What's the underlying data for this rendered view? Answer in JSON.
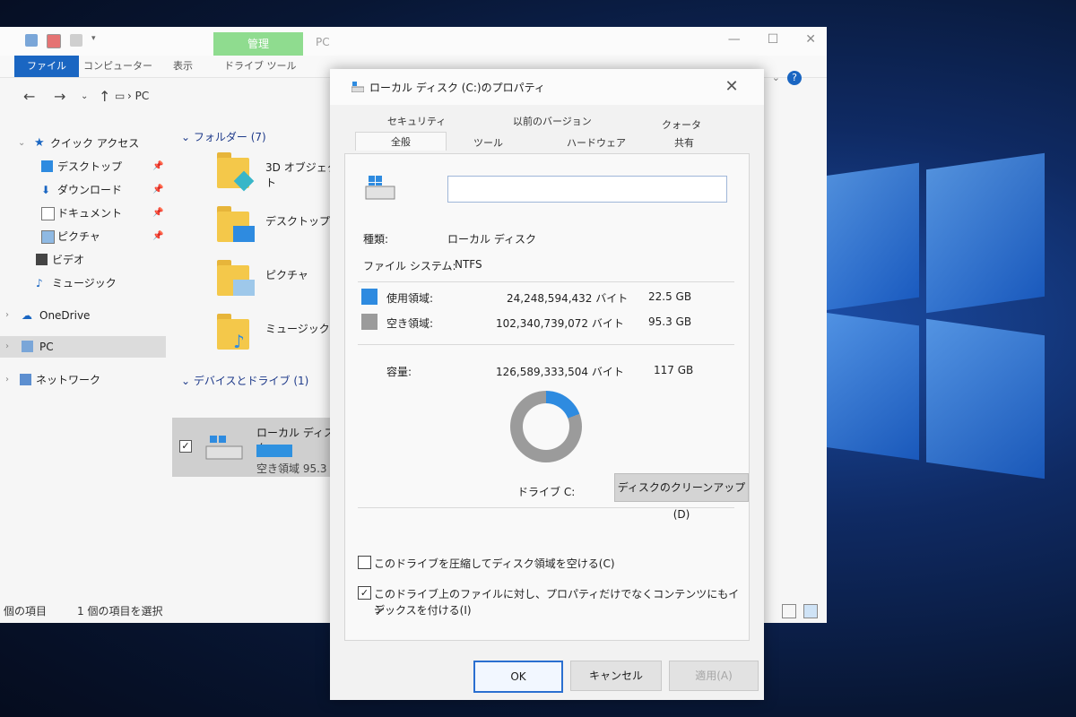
{
  "explorer": {
    "manage_tab": "管理",
    "window_title": "PC",
    "ribbon_tabs": [
      "ファイル",
      "コンピューター",
      "表示",
      "ドライブ ツール"
    ],
    "address_path": "PC",
    "sidebar": {
      "quick_access": "クイック アクセス",
      "items": [
        "デスクトップ",
        "ダウンロード",
        "ドキュメント",
        "ピクチャ",
        "ビデオ",
        "ミュージック"
      ],
      "onedrive": "OneDrive",
      "pc": "PC",
      "network": "ネットワーク"
    },
    "folders_header": "フォルダー (7)",
    "folders": [
      "3D オブジェクト",
      "デスクトップ",
      "ピクチャ",
      "ミュージック"
    ],
    "devices_header": "デバイスとドライブ (1)",
    "drive": {
      "name": "ローカル ディスク",
      "free": "空き領域 95.3",
      "used_fraction": 0.19
    },
    "status": {
      "count": "個の項目",
      "selected": "1 個の項目を選択"
    }
  },
  "dialog": {
    "title": "ローカル ディスク (C:)のプロパティ",
    "tabs_top": [
      "セキュリティ",
      "以前のバージョン",
      "クォータ"
    ],
    "tabs_bottom": [
      "全般",
      "ツール",
      "ハードウェア",
      "共有"
    ],
    "type_label": "種類:",
    "type_value": "ローカル ディスク",
    "fs_label": "ファイル システム:",
    "fs_value": "NTFS",
    "used": {
      "label": "使用領域:",
      "bytes": "24,248,594,432 バイト",
      "size": "22.5 GB",
      "color": "#2e8be0"
    },
    "free": {
      "label": "空き領域:",
      "bytes": "102,340,739,072 バイト",
      "size": "95.3 GB",
      "color": "#9b9b9b"
    },
    "capacity": {
      "label": "容量:",
      "bytes": "126,589,333,504 バイト",
      "size": "117 GB"
    },
    "drive_label": "ドライブ C:",
    "cleanup_button": "ディスクのクリーンアップ(D)",
    "compress_label": "このドライブを圧縮してディスク領域を空ける(C)",
    "compress_checked": false,
    "index_label_line1": "このドライブ上のファイルに対し、プロパティだけでなくコンテンツにもイン",
    "index_label_line2": "デックスを付ける(I)",
    "index_checked": true,
    "buttons": {
      "ok": "OK",
      "cancel": "キャンセル",
      "apply": "適用(A)"
    }
  }
}
